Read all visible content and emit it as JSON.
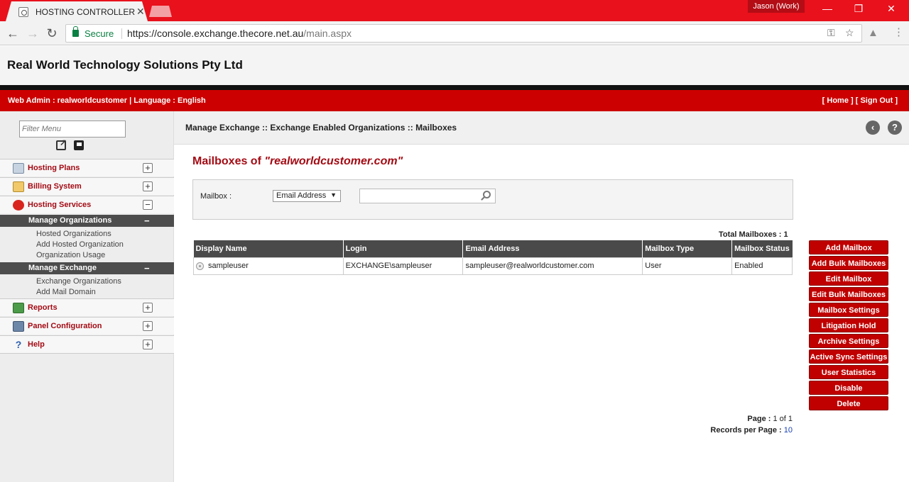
{
  "browser": {
    "tab_title": "HOSTING CONTROLLER",
    "profile": "Jason (Work)",
    "secure_label": "Secure",
    "url_main": "https://console.exchange.thecore.net.au",
    "url_path": "/main.aspx"
  },
  "header": {
    "company": "Real World Technology Solutions Pty Ltd",
    "info": "Web Admin : realworldcustomer | Language : English",
    "home_link": "[ Home ]",
    "signout_link": "[ Sign Out ]"
  },
  "sidebar": {
    "filter_placeholder": "Filter Menu",
    "menu": [
      {
        "label": "Hosting Plans",
        "toggle": "+"
      },
      {
        "label": "Billing System",
        "toggle": "+"
      },
      {
        "label": "Hosting Services",
        "toggle": "−"
      },
      {
        "label": "Reports",
        "toggle": "+"
      },
      {
        "label": "Panel Configuration",
        "toggle": "+"
      },
      {
        "label": "Help",
        "toggle": "+"
      }
    ],
    "submenus": [
      {
        "label": "Manage Organizations",
        "toggle": "−",
        "items": [
          "Hosted Organizations",
          "Add Hosted Organization",
          "Organization Usage"
        ]
      },
      {
        "label": "Manage Exchange",
        "toggle": "−",
        "items": [
          "Exchange Organizations",
          "Add Mail Domain"
        ]
      }
    ]
  },
  "main": {
    "breadcrumb": "Manage Exchange :: Exchange Enabled Organizations :: Mailboxes",
    "title_prefix": "Mailboxes of ",
    "title_domain": "\"realworldcustomer.com\"",
    "search": {
      "label": "Mailbox :",
      "field_select": "Email Address",
      "query": ""
    },
    "total_label": "Total Mailboxes :",
    "total_value": "1",
    "columns": [
      "Display Name",
      "Login",
      "Email Address",
      "Mailbox Type",
      "Mailbox Status"
    ],
    "rows": [
      {
        "display_name": "sampleuser",
        "login": "EXCHANGE\\sampleuser",
        "email": "sampleuser@realworldcustomer.com",
        "type": "User",
        "status": "Enabled"
      }
    ],
    "actions": [
      "Add Mailbox",
      "Add Bulk Mailboxes",
      "Edit Mailbox",
      "Edit Bulk Mailboxes",
      "Mailbox Settings",
      "Litigation Hold",
      "Archive Settings",
      "Active Sync Settings",
      "User Statistics",
      "Disable",
      "Delete"
    ],
    "pager": {
      "page_label": "Page :",
      "page_value": "1 of 1",
      "rpp_label": "Records per Page :",
      "rpp_value": "10"
    }
  }
}
